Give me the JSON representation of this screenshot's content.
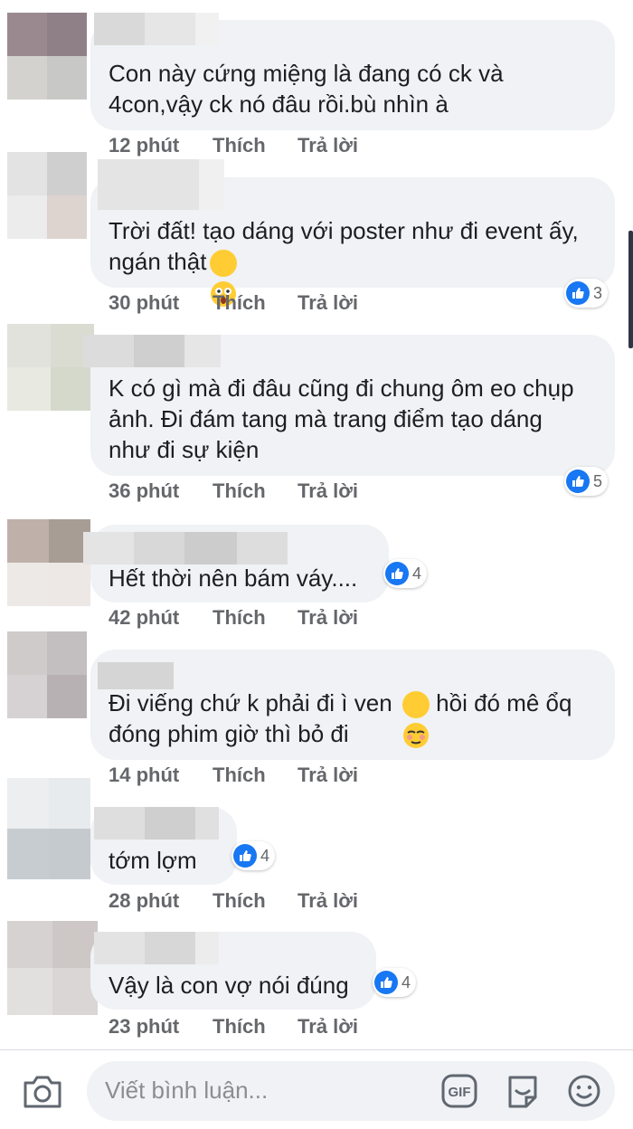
{
  "comments": [
    {
      "text": "Con này cứng miệng là đang có ck và\n4con,vậy ck nó đâu rồi.bù nhìn à",
      "time": "12 phút",
      "like": "Thích",
      "reply": "Trả lời",
      "reactions": ""
    },
    {
      "text": "Trời đất! tạo dáng với poster như đi event ấy,\nngán thật",
      "time": "30 phút",
      "like": "Thích",
      "reply": "Trả lời",
      "reactions": "3"
    },
    {
      "text": "K có gì mà đi đâu cũng đi chung ôm eo chụp\nảnh. Đi đám tang mà trang điểm tạo dáng\nnhư đi sự kiện",
      "time": "36 phút",
      "like": "Thích",
      "reply": "Trả lời",
      "reactions": "5"
    },
    {
      "text": "Hết thời nên bám váy....",
      "time": "42 phút",
      "like": "Thích",
      "reply": "Trả lời",
      "reactions": "4"
    },
    {
      "text": "Đi viếng chứ k phải đi ì ven",
      "text2": " hồi đó mê ổq\nđóng phim giờ thì bỏ đi",
      "time": "14 phút",
      "like": "Thích",
      "reply": "Trả lời",
      "reactions": ""
    },
    {
      "text": "tớm  lợm",
      "time": "28 phút",
      "like": "Thích",
      "reply": "Trả lời",
      "reactions": "4"
    },
    {
      "text": "Vậy là con vợ nói đúng",
      "time": "23 phút",
      "like": "Thích",
      "reply": "Trả lời",
      "reactions": "4"
    }
  ],
  "composer": {
    "placeholder": "Viết bình luận..."
  },
  "icons": {
    "like": "thumbs-up-icon",
    "camera": "camera-icon",
    "gif": "gif-icon",
    "sticker": "sticker-icon",
    "emoji": "smile-icon"
  },
  "colors": {
    "bubble": "#f0f2f5",
    "meta": "#65676b",
    "like_blue": "#1877f2"
  }
}
